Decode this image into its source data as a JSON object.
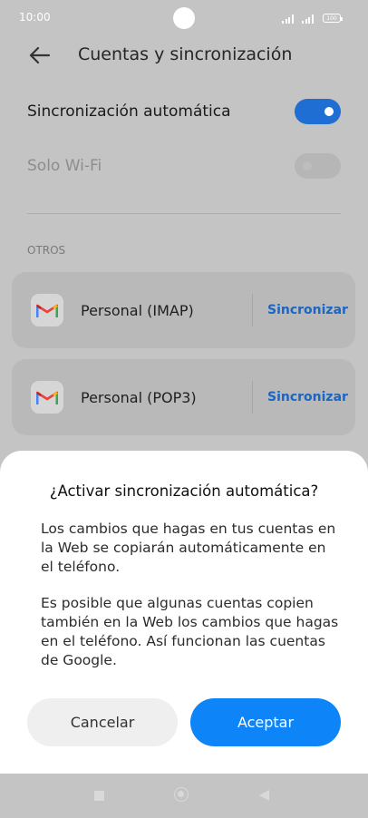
{
  "status_bar": {
    "time": "10:00",
    "battery": "100"
  },
  "header": {
    "title": "Cuentas y sincronización"
  },
  "settings": {
    "auto_sync": {
      "label": "Sincronización automática",
      "enabled": true
    },
    "wifi_only": {
      "label": "Solo Wi-Fi",
      "enabled": false
    }
  },
  "section_label": "OTROS",
  "accounts": [
    {
      "name": "Personal (IMAP)",
      "action": "Sincronizar"
    },
    {
      "name": "Personal (POP3)",
      "action": "Sincronizar"
    }
  ],
  "dialog": {
    "title": "¿Activar sincronización automática?",
    "paragraph1": "Los cambios que hagas en tus cuentas en la Web se copiarán automáticamente en el teléfono.",
    "paragraph2": "Es posible que algunas cuentas copien también en la Web los cambios que hagas en el teléfono. Así funcionan las cuentas de Google.",
    "cancel_label": "Cancelar",
    "accept_label": "Aceptar"
  },
  "colors": {
    "accent": "#0d84f7",
    "link": "#1a66c4",
    "toggle_on": "#1f6ed4"
  },
  "icons": [
    "back-arrow-icon",
    "gmail-icon",
    "signal-icon",
    "battery-icon",
    "nav-recents-icon",
    "nav-home-icon",
    "nav-back-icon"
  ]
}
